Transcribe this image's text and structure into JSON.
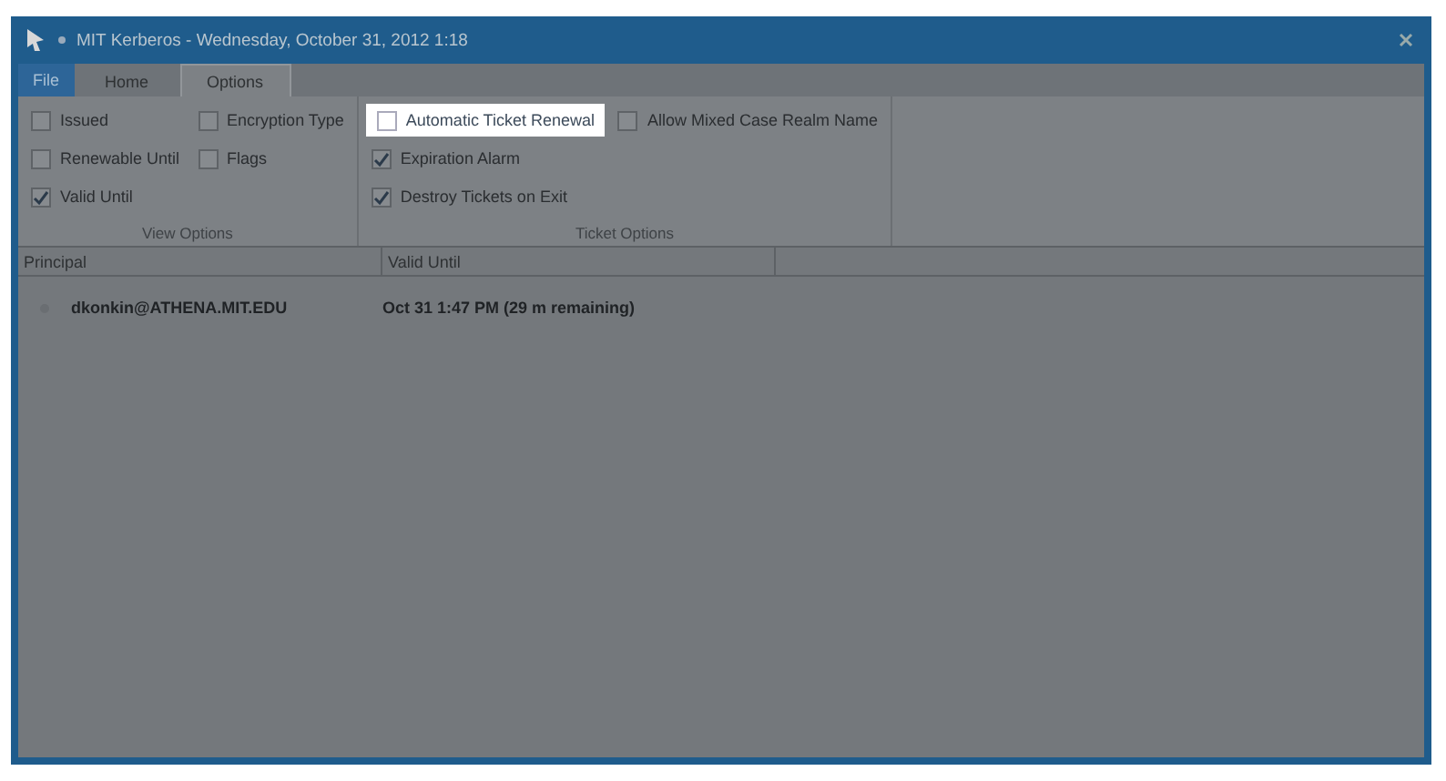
{
  "window": {
    "title": "MIT Kerberos - Wednesday, October 31, 2012 1:18"
  },
  "tabs": [
    {
      "label": "File",
      "kind": "file",
      "selected": false
    },
    {
      "label": "Home",
      "kind": "tab",
      "selected": false
    },
    {
      "label": "Options",
      "kind": "tab",
      "selected": true
    }
  ],
  "ribbon_groups": [
    {
      "label": "View Options",
      "columns": [
        [
          {
            "label": "Issued",
            "checked": false,
            "highlighted": false
          },
          {
            "label": "Renewable Until",
            "checked": false,
            "highlighted": false
          },
          {
            "label": "Valid Until",
            "checked": true,
            "highlighted": false
          }
        ],
        [
          {
            "label": "Encryption Type",
            "checked": false,
            "highlighted": false
          },
          {
            "label": "Flags",
            "checked": false,
            "highlighted": false
          }
        ]
      ]
    },
    {
      "label": "Ticket Options",
      "columns": [
        [
          {
            "label": "Automatic Ticket Renewal",
            "checked": false,
            "highlighted": true
          },
          {
            "label": "Expiration Alarm",
            "checked": true,
            "highlighted": false
          },
          {
            "label": "Destroy Tickets on Exit",
            "checked": true,
            "highlighted": false
          }
        ],
        [
          {
            "label": "Allow Mixed Case Realm Name",
            "checked": false,
            "highlighted": false
          }
        ]
      ]
    }
  ],
  "table": {
    "columns": [
      "Principal",
      "Valid Until"
    ],
    "rows": [
      {
        "cells": [
          "dkonkin@ATHENA.MIT.EDU",
          "Oct 31  1:47 PM (29 m remaining)"
        ]
      }
    ]
  }
}
